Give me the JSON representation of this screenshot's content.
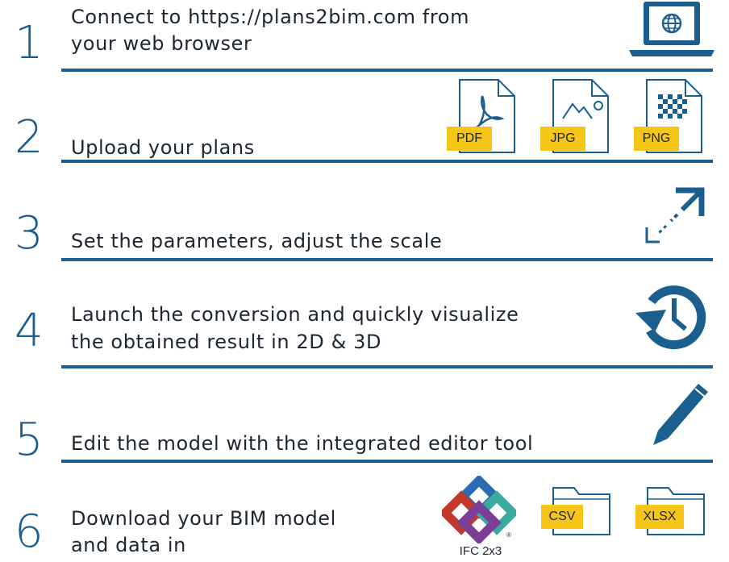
{
  "steps": [
    {
      "number": "1",
      "lines": [
        "Connect to https://plans2bim.com from",
        "your web browser"
      ]
    },
    {
      "number": "2",
      "lines": [
        "Upload your plans"
      ]
    },
    {
      "number": "3",
      "lines": [
        "Set the parameters, adjust the scale"
      ]
    },
    {
      "number": "4",
      "lines": [
        "Launch the conversion and quickly visualize",
        "the obtained result in 2D & 3D"
      ]
    },
    {
      "number": "5",
      "lines": [
        "Edit the model with the integrated editor tool"
      ]
    },
    {
      "number": "6",
      "lines": [
        "Download your BIM model",
        "and data in"
      ]
    }
  ],
  "file_types": {
    "pdf": "PDF",
    "jpg": "JPG",
    "png": "PNG"
  },
  "export_formats": {
    "ifc": "IFC 2x3",
    "csv": "CSV",
    "xlsx": "XLSX"
  },
  "icons": {
    "step1": "laptop-globe-icon",
    "step3": "resize-arrow-icon",
    "step4": "history-clock-icon",
    "step5": "pencil-icon",
    "step6": "ifc-logo-icon"
  },
  "colors": {
    "accent": "#1b5f8f",
    "tag": "#f5c518",
    "text": "#1d2530"
  }
}
